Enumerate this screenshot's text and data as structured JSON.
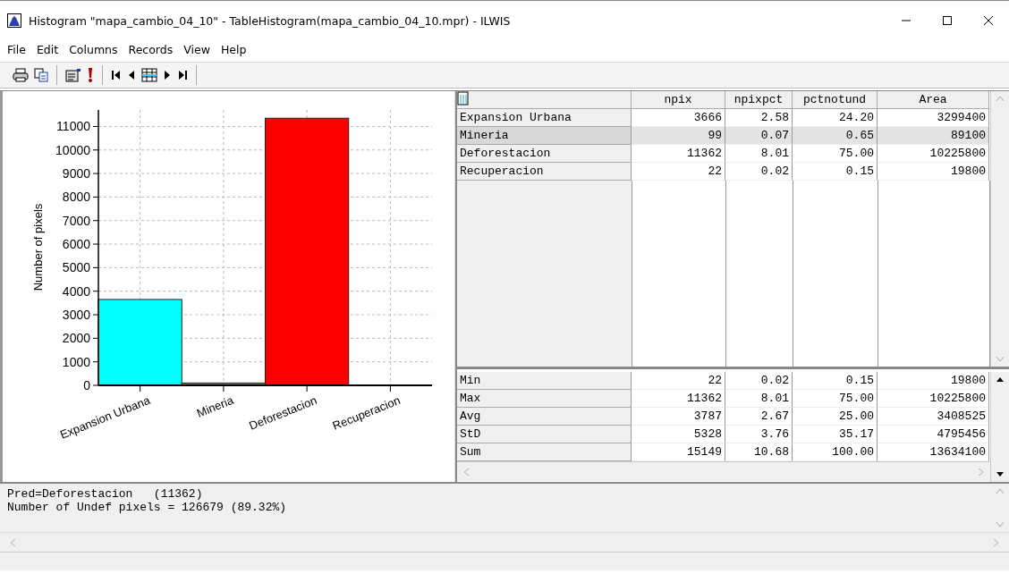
{
  "window": {
    "title": "Histogram \"mapa_cambio_04_10\" - TableHistogram(mapa_cambio_04_10.mpr) - ILWIS"
  },
  "menu": [
    "File",
    "Edit",
    "Columns",
    "Records",
    "View",
    "Help"
  ],
  "chart": {
    "chart_data": {
      "type": "bar",
      "ylabel": "Number of pixels",
      "categories": [
        "Expansion Urbana",
        "Mineria",
        "Deforestacion",
        "Recuperacion"
      ],
      "values": [
        3650,
        100,
        11350,
        null
      ],
      "colors": [
        "#00ffff",
        "#808000",
        "#ff0000",
        null
      ],
      "grid": true,
      "ylim": [
        0,
        11700
      ],
      "yticks": [
        0,
        1000,
        2000,
        3000,
        4000,
        5000,
        6000,
        7000,
        8000,
        9000,
        10000,
        11000
      ]
    }
  },
  "table": {
    "columns": [
      "npix",
      "npixpct",
      "pctnotund",
      "Area"
    ],
    "rows": [
      {
        "name": "Expansion Urbana",
        "values": [
          "3666",
          "2.58",
          "24.20",
          "3299400"
        ],
        "selected": false
      },
      {
        "name": "Mineria",
        "values": [
          "99",
          "0.07",
          "0.65",
          "89100"
        ],
        "selected": true
      },
      {
        "name": "Deforestacion",
        "values": [
          "11362",
          "8.01",
          "75.00",
          "10225800"
        ],
        "selected": false
      },
      {
        "name": "Recuperacion",
        "values": [
          "22",
          "0.02",
          "0.15",
          "19800"
        ],
        "selected": false
      }
    ],
    "stats": [
      {
        "name": "Min",
        "values": [
          "22",
          "0.02",
          "0.15",
          "19800"
        ]
      },
      {
        "name": "Max",
        "values": [
          "11362",
          "8.01",
          "75.00",
          "10225800"
        ]
      },
      {
        "name": "Avg",
        "values": [
          "3787",
          "2.67",
          "25.00",
          "3408525"
        ]
      },
      {
        "name": "StD",
        "values": [
          "5328",
          "3.76",
          "35.17",
          "4795456"
        ]
      },
      {
        "name": "Sum",
        "values": [
          "15149",
          "10.68",
          "100.00",
          "13634100"
        ]
      }
    ]
  },
  "info": [
    "Pred=Deforestacion   (11362)",
    "Number of Undef pixels = 126679 (89.32%)"
  ]
}
